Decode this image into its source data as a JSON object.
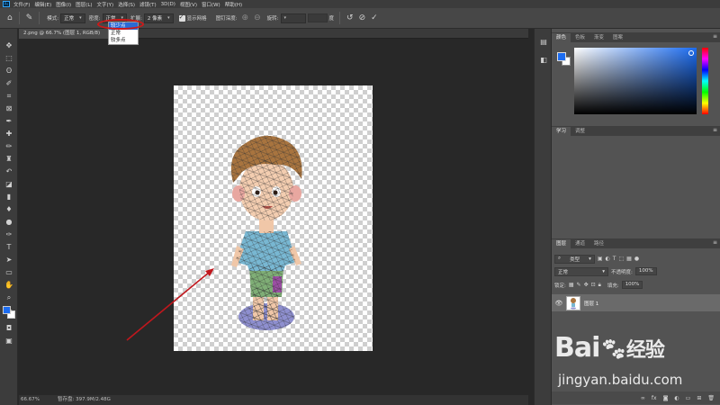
{
  "app": {
    "logo_text": "Ps"
  },
  "menu": [
    "文件(F)",
    "编辑(E)",
    "图像(I)",
    "图层(L)",
    "文字(Y)",
    "选择(S)",
    "滤镜(T)",
    "3D(D)",
    "视图(V)",
    "窗口(W)",
    "帮助(H)"
  ],
  "options": {
    "mode_label": "模式:",
    "mode_value": "正常",
    "density_label": "密度:",
    "density_value": "正常",
    "expand_label": "扩展:",
    "expand_value": "2 像素",
    "show_mesh_label": "显示网格",
    "show_mesh_checked": true,
    "pin_depth_label": "图钉深度:",
    "rotate_label": "旋转:",
    "rotate_unit": "度",
    "reset_icon": "reset-icon",
    "cancel_icon": "cancel-icon",
    "commit_icon": "commit-check-icon"
  },
  "density_dropdown": {
    "options": [
      "较少点",
      "正常",
      "较多点"
    ],
    "selected_index": 0
  },
  "document": {
    "tab_title": "2.png @ 66.7% (图层 1, RGB/8)",
    "zoom": "66.67%",
    "scratch": "暂存盘: 397.9M/2.48G"
  },
  "colors": {
    "accent": "#1c6cf0",
    "annotation": "#c0171d",
    "oval": "#d01818"
  },
  "panels": {
    "color_tabs": [
      "颜色",
      "色板",
      "渐变",
      "图案"
    ],
    "learn_tabs": [
      "学习",
      "调整"
    ],
    "layers_tabs": [
      "图层",
      "通道",
      "路径"
    ],
    "kind_value": "类型",
    "blend_mode": "正常",
    "opacity_label": "不透明度:",
    "opacity_value": "100%",
    "lock_label": "锁定:",
    "fill_label": "填充:",
    "fill_value": "100%",
    "layer_name": "图层 1",
    "footer_icons": [
      "link-icon",
      "fx-icon",
      "mask-icon",
      "adjustment-icon",
      "group-icon",
      "new-layer-icon",
      "trash-icon"
    ]
  },
  "watermark": {
    "brand": "Bai",
    "brand_cn": "经验",
    "url": "jingyan.baidu.com"
  }
}
